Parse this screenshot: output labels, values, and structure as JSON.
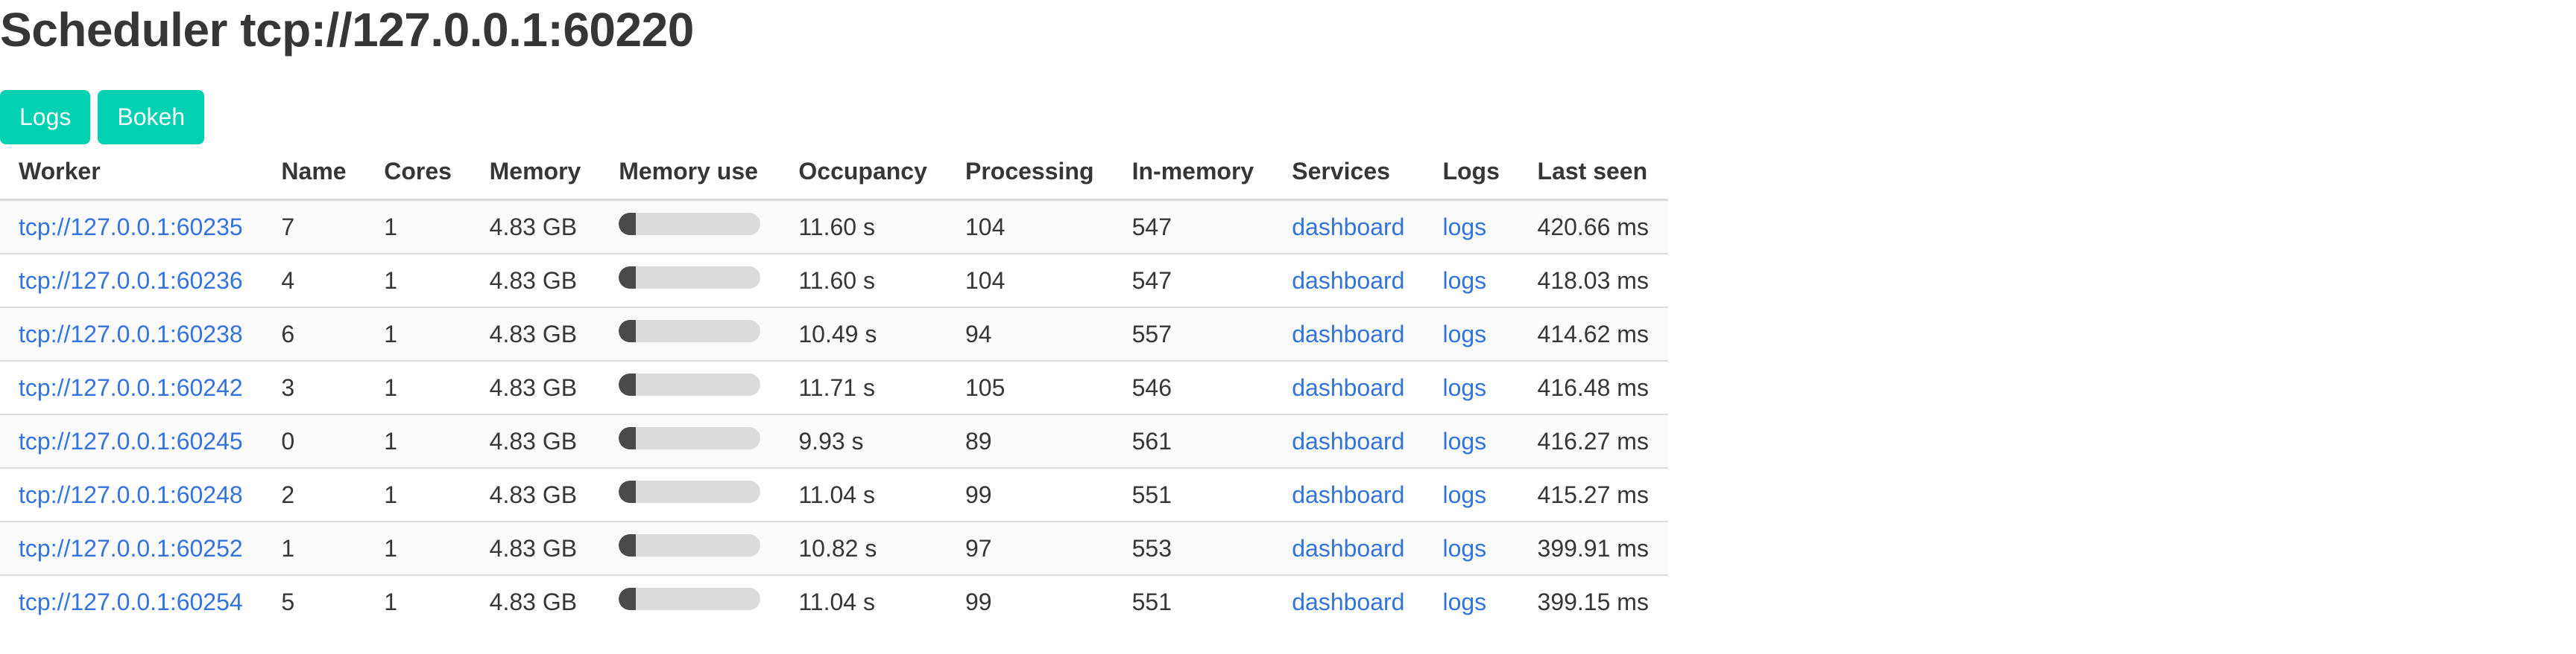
{
  "page": {
    "title": "Scheduler tcp://127.0.0.1:60220"
  },
  "buttons": {
    "logs": "Logs",
    "bokeh": "Bokeh"
  },
  "colors": {
    "primary_button": "#00d1b2",
    "link": "#3273dc",
    "bar_fill": "#4a4a4a",
    "bar_track": "#dbdbdb"
  },
  "table": {
    "headers": [
      "Worker",
      "Name",
      "Cores",
      "Memory",
      "Memory use",
      "Occupancy",
      "Processing",
      "In-memory",
      "Services",
      "Logs",
      "Last seen"
    ],
    "rows": [
      {
        "worker": "tcp://127.0.0.1:60235",
        "name": "7",
        "cores": "1",
        "memory": "4.83 GB",
        "memory_use": 0.12,
        "occupancy": "11.60 s",
        "processing": "104",
        "in_memory": "547",
        "services": "dashboard",
        "logs": "logs",
        "last_seen": "420.66 ms"
      },
      {
        "worker": "tcp://127.0.0.1:60236",
        "name": "4",
        "cores": "1",
        "memory": "4.83 GB",
        "memory_use": 0.12,
        "occupancy": "11.60 s",
        "processing": "104",
        "in_memory": "547",
        "services": "dashboard",
        "logs": "logs",
        "last_seen": "418.03 ms"
      },
      {
        "worker": "tcp://127.0.0.1:60238",
        "name": "6",
        "cores": "1",
        "memory": "4.83 GB",
        "memory_use": 0.12,
        "occupancy": "10.49 s",
        "processing": "94",
        "in_memory": "557",
        "services": "dashboard",
        "logs": "logs",
        "last_seen": "414.62 ms"
      },
      {
        "worker": "tcp://127.0.0.1:60242",
        "name": "3",
        "cores": "1",
        "memory": "4.83 GB",
        "memory_use": 0.12,
        "occupancy": "11.71 s",
        "processing": "105",
        "in_memory": "546",
        "services": "dashboard",
        "logs": "logs",
        "last_seen": "416.48 ms"
      },
      {
        "worker": "tcp://127.0.0.1:60245",
        "name": "0",
        "cores": "1",
        "memory": "4.83 GB",
        "memory_use": 0.12,
        "occupancy": "9.93 s",
        "processing": "89",
        "in_memory": "561",
        "services": "dashboard",
        "logs": "logs",
        "last_seen": "416.27 ms"
      },
      {
        "worker": "tcp://127.0.0.1:60248",
        "name": "2",
        "cores": "1",
        "memory": "4.83 GB",
        "memory_use": 0.12,
        "occupancy": "11.04 s",
        "processing": "99",
        "in_memory": "551",
        "services": "dashboard",
        "logs": "logs",
        "last_seen": "415.27 ms"
      },
      {
        "worker": "tcp://127.0.0.1:60252",
        "name": "1",
        "cores": "1",
        "memory": "4.83 GB",
        "memory_use": 0.12,
        "occupancy": "10.82 s",
        "processing": "97",
        "in_memory": "553",
        "services": "dashboard",
        "logs": "logs",
        "last_seen": "399.91 ms"
      },
      {
        "worker": "tcp://127.0.0.1:60254",
        "name": "5",
        "cores": "1",
        "memory": "4.83 GB",
        "memory_use": 0.12,
        "occupancy": "11.04 s",
        "processing": "99",
        "in_memory": "551",
        "services": "dashboard",
        "logs": "logs",
        "last_seen": "399.15 ms"
      }
    ]
  }
}
